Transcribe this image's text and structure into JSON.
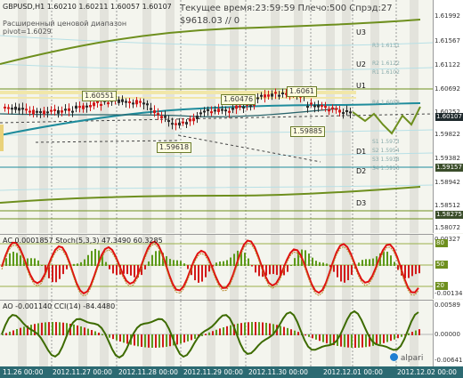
{
  "chart_header": {
    "symbol_line": "GBPUSD,H1  1.60210 1.60211 1.60057 1.60107",
    "indicator_line1": "Расширенный ценовой диапазон",
    "indicator_line2": "pivot=1.6029",
    "time_line": "Текущее время:23:59:59 Плечо:500 Спрэд:27",
    "balance_line": "$9618.03     // 0"
  },
  "price_axis": [
    "1.61992",
    "1.61567",
    "1.61122",
    "1.60692",
    "1.60252",
    "1.60107",
    "1.59822",
    "1.59382",
    "1.59157",
    "1.58942",
    "1.58512",
    "1.58275",
    "1.58072"
  ],
  "price_highlights": {
    "current": "1.60107",
    "level_1": "1.59157",
    "level_2": "1.58275",
    "current_color": "#1f2a2d",
    "level_color": "#3a4d2a"
  },
  "levels": [
    "U3",
    "U2",
    "U1",
    "D1",
    "D2",
    "D3"
  ],
  "faint_levels": [
    "R3 1.6131",
    "R2 1.6122",
    "R1 1.6102",
    "R4 1.6058",
    "S1 1.5973",
    "S2 1.5954",
    "S3 1.5938",
    "S4 1.5916"
  ],
  "callouts": [
    "1.60551",
    "1.60476",
    "1.6061",
    "1.59618",
    "1.59885"
  ],
  "indicator1": {
    "label": "AC 0.0001857   Stoch(5,3,3) 47.3490 60.3285",
    "axis": [
      "0.00327",
      "80",
      "50",
      "20",
      "-0.00134"
    ]
  },
  "indicator2": {
    "label": "AO -0.001140   CCI(14) -84.4480",
    "axis": [
      "0.00589",
      "0.00000",
      "-0.00641"
    ]
  },
  "time_axis": [
    "11.26 00:00",
    "2012.11.27 00:00",
    "2012.11.28 00:00",
    "2012.11.29 00:00",
    "2012.11.30 00:00",
    "2012.12.01 00:00",
    "2012.12.02 00:00"
  ],
  "logo": "alpari",
  "colors": {
    "background": "#f4f5ee",
    "price_line": "#1e8c9c",
    "candle_red": "#d21a1a",
    "candle_dark": "#2a2a2a",
    "level_green": "#6e8f1e",
    "stoch_red": "#e01010",
    "oscillator_green": "#3d6b00"
  }
}
